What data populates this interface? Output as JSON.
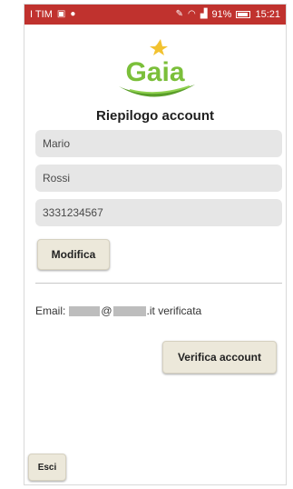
{
  "statusbar": {
    "carrier": "I TIM",
    "battery": "91%",
    "time": "15:21",
    "color": "#c0322e"
  },
  "logo": {
    "text": "Gaia",
    "colors": {
      "text": "#7bbf3a",
      "leaf": "#5a9e2a",
      "spark": "#f2c230"
    }
  },
  "header": {
    "title": "Riepilogo account"
  },
  "form": {
    "first_name": "Mario",
    "last_name": "Rossi",
    "phone": "3331234567",
    "edit_label": "Modifica"
  },
  "email": {
    "prefix": "Email:",
    "at": "@",
    "suffix": ".it verificata"
  },
  "actions": {
    "verify_label": "Verifica account",
    "exit_label": "Esci"
  }
}
